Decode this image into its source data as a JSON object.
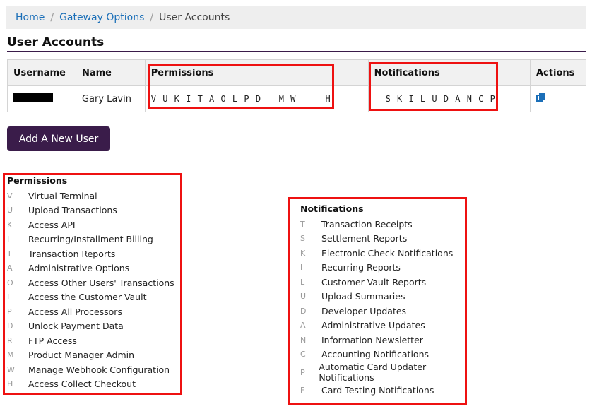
{
  "breadcrumb": {
    "home": "Home",
    "sep": "/",
    "gateway_options": "Gateway Options",
    "current": "User Accounts"
  },
  "page_title": "User Accounts",
  "table": {
    "headers": {
      "username": "Username",
      "name": "Name",
      "permissions": "Permissions",
      "notifications": "Notifications",
      "actions": "Actions"
    },
    "rows": [
      {
        "name": "Gary Lavin",
        "permissions": "V U K I T A O L P D   M W     H",
        "notifications": "S K I L U D A N C P"
      }
    ]
  },
  "add_user_button": "Add A New User",
  "permissions_legend": {
    "title": "Permissions",
    "items": [
      {
        "code": "V",
        "label": "Virtual Terminal"
      },
      {
        "code": "U",
        "label": "Upload Transactions"
      },
      {
        "code": "K",
        "label": "Access API"
      },
      {
        "code": "I",
        "label": "Recurring/Installment Billing"
      },
      {
        "code": "T",
        "label": "Transaction Reports"
      },
      {
        "code": "A",
        "label": "Administrative Options"
      },
      {
        "code": "O",
        "label": "Access Other Users' Transactions"
      },
      {
        "code": "L",
        "label": "Access the Customer Vault"
      },
      {
        "code": "P",
        "label": "Access All Processors"
      },
      {
        "code": "D",
        "label": "Unlock Payment Data"
      },
      {
        "code": "R",
        "label": "FTP Access"
      },
      {
        "code": "M",
        "label": "Product Manager Admin"
      },
      {
        "code": "W",
        "label": "Manage Webhook Configuration"
      },
      {
        "code": "H",
        "label": "Access Collect Checkout"
      }
    ]
  },
  "notifications_legend": {
    "title": "Notifications",
    "items": [
      {
        "code": "T",
        "label": "Transaction Receipts"
      },
      {
        "code": "S",
        "label": "Settlement Reports"
      },
      {
        "code": "K",
        "label": "Electronic Check Notifications"
      },
      {
        "code": "I",
        "label": "Recurring Reports"
      },
      {
        "code": "L",
        "label": "Customer Vault Reports"
      },
      {
        "code": "U",
        "label": "Upload Summaries"
      },
      {
        "code": "D",
        "label": "Developer Updates"
      },
      {
        "code": "A",
        "label": "Administrative Updates"
      },
      {
        "code": "N",
        "label": "Information Newsletter"
      },
      {
        "code": "C",
        "label": "Accounting Notifications"
      },
      {
        "code": "P",
        "label": "Automatic Card Updater Notifications"
      },
      {
        "code": "F",
        "label": "Card Testing Notifications"
      }
    ]
  },
  "colors": {
    "brand_purple": "#3a1c4a",
    "link_blue": "#1b6fb8",
    "highlight_red": "#ee1111"
  },
  "icons": {
    "copy": "copy-icon"
  }
}
